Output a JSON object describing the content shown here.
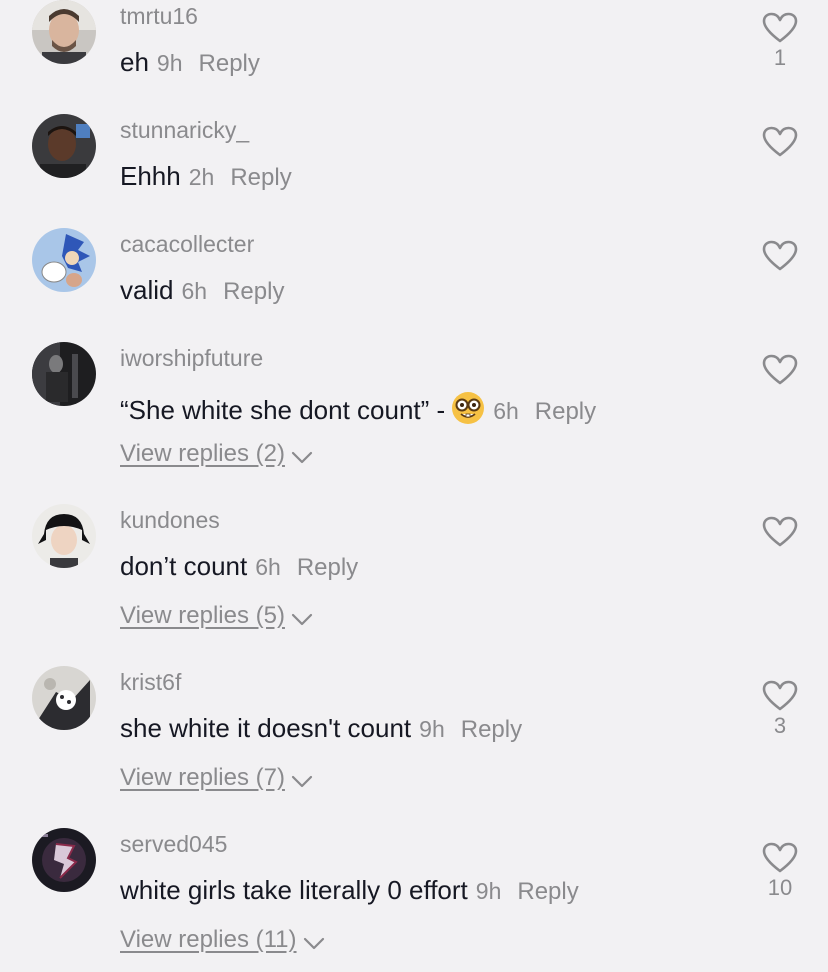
{
  "comments": [
    {
      "username": "tmrtu16",
      "text": "eh",
      "time": "9h",
      "reply_label": "Reply",
      "likes": "1",
      "view_replies": ""
    },
    {
      "username": "stunnaricky_",
      "text": "Ehhh",
      "time": "2h",
      "reply_label": "Reply",
      "likes": "",
      "view_replies": ""
    },
    {
      "username": "cacacollecter",
      "text": "valid",
      "time": "6h",
      "reply_label": "Reply",
      "likes": "",
      "view_replies": ""
    },
    {
      "username": "iworshipfuture",
      "text": "“She white she dont count” -",
      "emoji": "nerd-face-emoji",
      "time": "6h",
      "reply_label": "Reply",
      "likes": "",
      "view_replies": "View replies (2)"
    },
    {
      "username": "kundones",
      "text": "don’t count",
      "time": "6h",
      "reply_label": "Reply",
      "likes": "",
      "view_replies": "View replies (5)"
    },
    {
      "username": "krist6f",
      "text": "she white it doesn't count",
      "time": "9h",
      "reply_label": "Reply",
      "likes": "3",
      "view_replies": "View replies (7)"
    },
    {
      "username": "served045",
      "text": "white girls take literally 0 effort",
      "time": "9h",
      "reply_label": "Reply",
      "likes": "10",
      "view_replies": "View replies (11)"
    }
  ],
  "icons": {
    "like": "heart-outline-icon",
    "expand": "chevron-down-icon"
  },
  "colors": {
    "background": "#f2f1f3",
    "text": "#161823",
    "muted": "#8a8a8d"
  }
}
